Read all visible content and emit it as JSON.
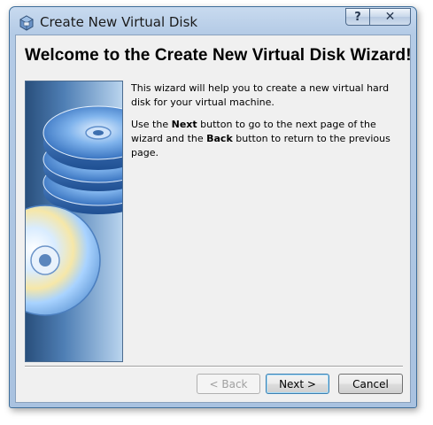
{
  "window": {
    "title": "Create New Virtual Disk",
    "help_button": "?",
    "close_button": "✕"
  },
  "wizard": {
    "heading": "Welcome to the Create New Virtual Disk Wizard!",
    "paragraph1": "This wizard will help you to create a new virtual hard disk for your virtual machine.",
    "p2_part1": "Use the ",
    "p2_next": "Next",
    "p2_part2": " button to go to the next page of the wizard and the ",
    "p2_back": "Back",
    "p2_part3": " button to return to the previous page."
  },
  "buttons": {
    "back": "< Back",
    "next": "Next >",
    "cancel": "Cancel"
  },
  "icons": {
    "app": "virtualbox-cube-icon",
    "help": "help-icon",
    "close": "close-icon"
  },
  "colors": {
    "frame": "#b4cbe6",
    "client": "#f0f0f0",
    "side_art_dark": "#294f7c",
    "side_art_light": "#b9d4ee"
  }
}
